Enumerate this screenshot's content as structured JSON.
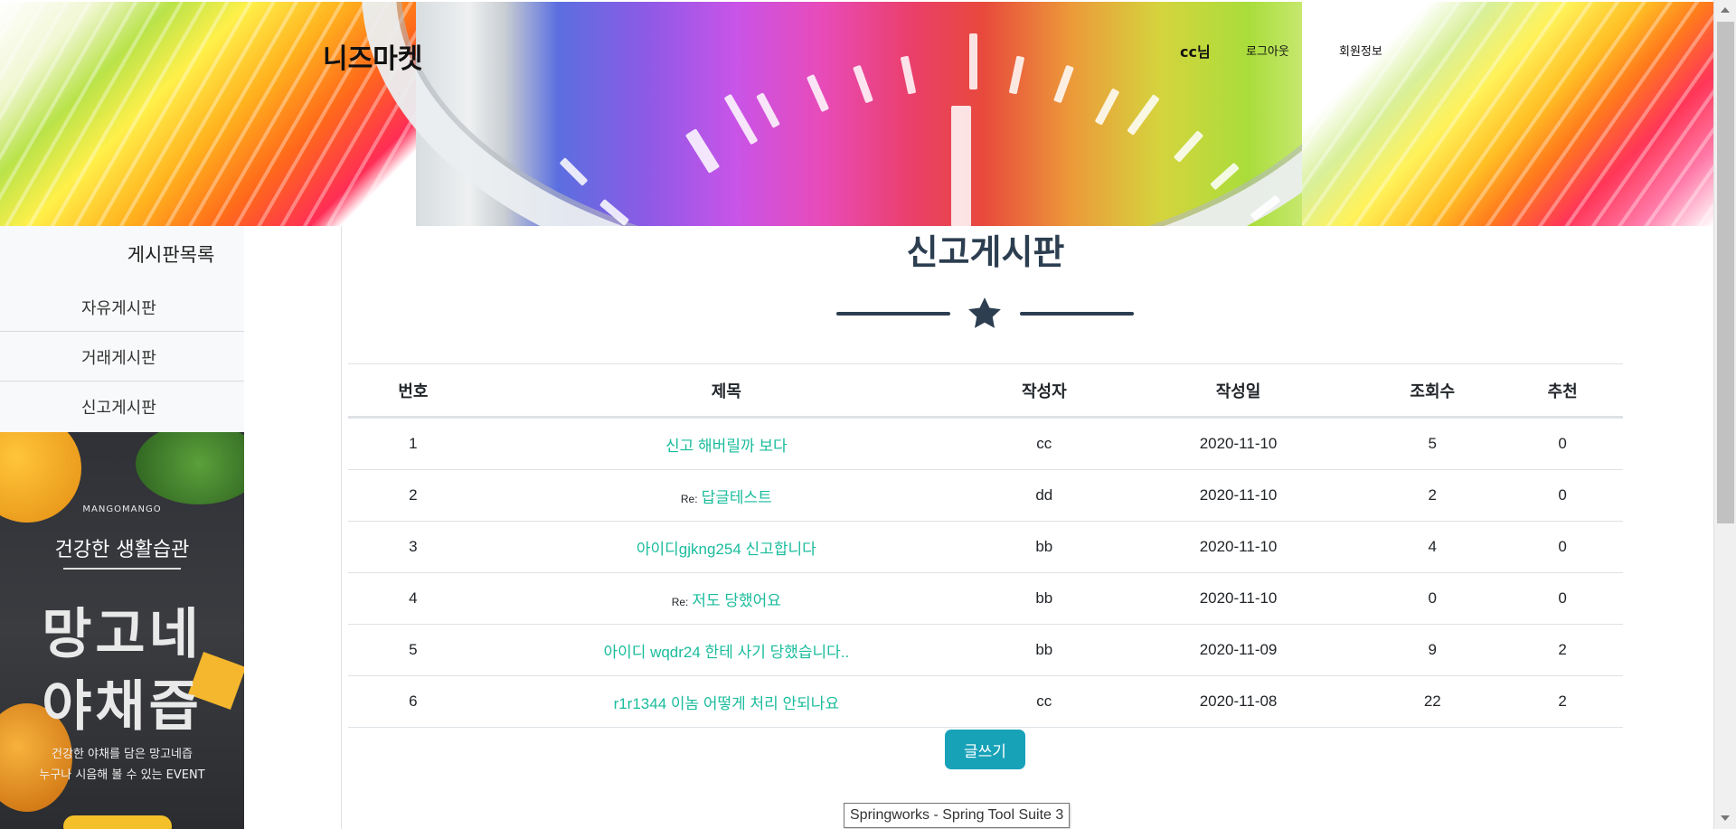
{
  "header": {
    "site_title": "니즈마켓",
    "user_greeting": "cc님",
    "logout_label": "로그아웃",
    "member_info_label": "회원정보"
  },
  "sidebar": {
    "title": "게시판목록",
    "items": [
      {
        "label": "자유게시판"
      },
      {
        "label": "거래게시판"
      },
      {
        "label": "신고게시판"
      }
    ],
    "promo": {
      "brand": "MANGOMANGO",
      "subtitle": "건강한 생활습관",
      "headline_1": "망고네",
      "headline_2": "야채즙",
      "line_1": "건강한 야채를 담은 망고네즙",
      "line_2": "누구나 시음해 볼 수 있는 EVENT"
    }
  },
  "main": {
    "board_title": "신고게시판",
    "divider_icon": "star-icon",
    "columns": [
      "번호",
      "제목",
      "작성자",
      "작성일",
      "조회수",
      "추천"
    ],
    "rows": [
      {
        "no": "1",
        "prefix": "",
        "title": "신고 해버릴까 보다",
        "author": "cc",
        "date": "2020-11-10",
        "views": "5",
        "likes": "0"
      },
      {
        "no": "2",
        "prefix": "Re:",
        "title": "답글테스트",
        "author": "dd",
        "date": "2020-11-10",
        "views": "2",
        "likes": "0"
      },
      {
        "no": "3",
        "prefix": "",
        "title": "아이디gjkng254 신고합니다",
        "author": "bb",
        "date": "2020-11-10",
        "views": "4",
        "likes": "0"
      },
      {
        "no": "4",
        "prefix": "Re:",
        "title": "저도 당했어요",
        "author": "bb",
        "date": "2020-11-10",
        "views": "0",
        "likes": "0"
      },
      {
        "no": "5",
        "prefix": "",
        "title": "아이디 wqdr24 한테 사기 당했습니다..",
        "author": "bb",
        "date": "2020-11-09",
        "views": "9",
        "likes": "2"
      },
      {
        "no": "6",
        "prefix": "",
        "title": "r1r1344 이놈 어떻게 처리 안되나요",
        "author": "cc",
        "date": "2020-11-08",
        "views": "22",
        "likes": "2"
      }
    ],
    "write_button_label": "글쓰기"
  },
  "tooltip": {
    "text": "Springworks - Spring Tool Suite 3"
  },
  "colors": {
    "title_dark": "#2c3e50",
    "link_teal": "#1abc9c",
    "button_teal": "#17a2b8"
  }
}
